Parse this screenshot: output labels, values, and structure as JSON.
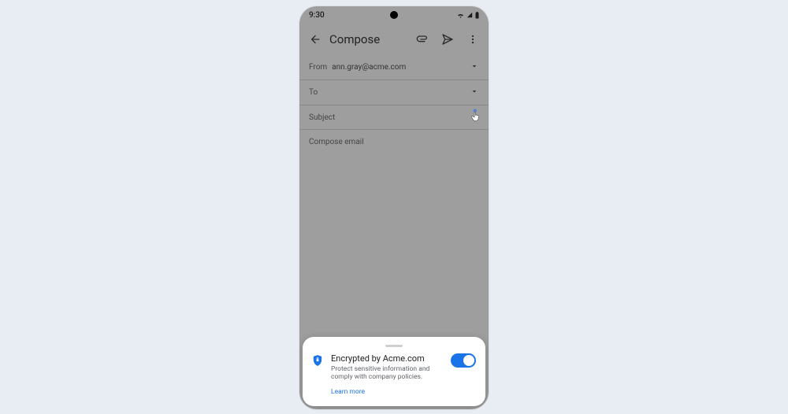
{
  "status": {
    "time": "9:30"
  },
  "appbar": {
    "title": "Compose"
  },
  "from": {
    "label": "From",
    "value": "ann.gray@acme.com"
  },
  "to": {
    "label": "To"
  },
  "subject": {
    "placeholder": "Subject"
  },
  "body": {
    "placeholder": "Compose email"
  },
  "sheet": {
    "title": "Encrypted by Acme.com",
    "subtitle": "Protect sensitive information and comply with company policies.",
    "link": "Learn more",
    "toggle_on": true
  },
  "colors": {
    "accent": "#1a73e8",
    "page_bg": "#e8ecf3",
    "phone_bg": "#9e9e9e"
  }
}
